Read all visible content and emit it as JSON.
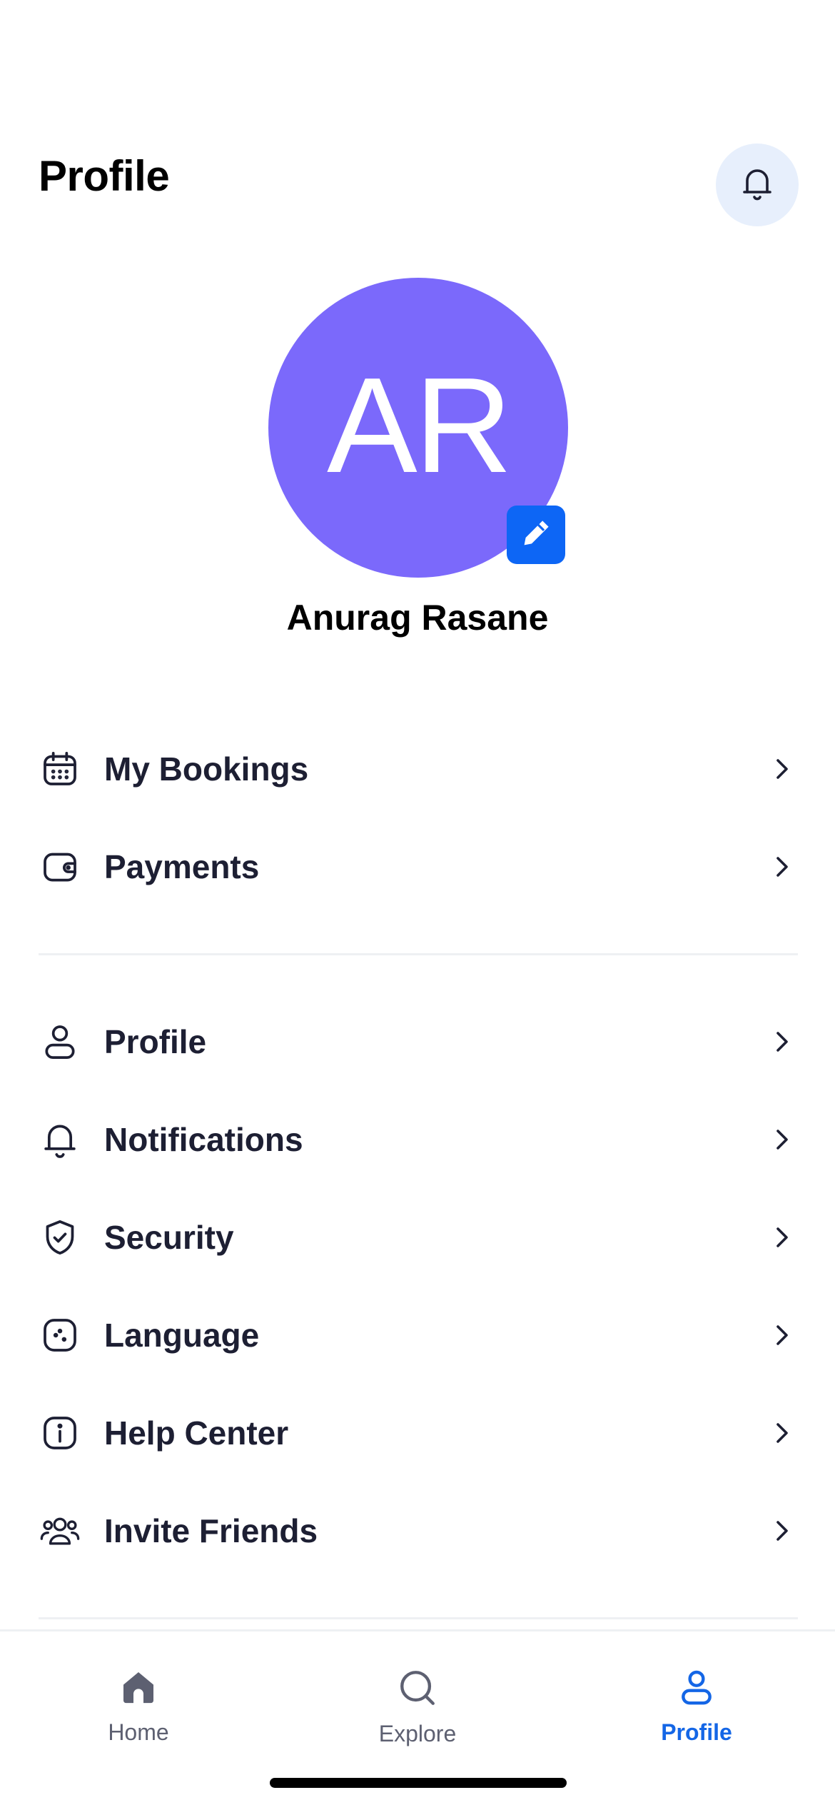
{
  "header": {
    "title": "Profile",
    "notification_icon": "bell-icon"
  },
  "profile": {
    "initials": "AR",
    "name": "Anurag Rasane",
    "avatar_color": "#7b69fb",
    "edit_icon": "pencil-icon",
    "edit_color": "#0d66f5"
  },
  "menu_groups": [
    {
      "items": [
        {
          "label": "My Bookings",
          "icon": "calendar-icon"
        },
        {
          "label": "Payments",
          "icon": "wallet-icon"
        }
      ]
    },
    {
      "items": [
        {
          "label": "Profile",
          "icon": "user-icon"
        },
        {
          "label": "Notifications",
          "icon": "bell-icon"
        },
        {
          "label": "Security",
          "icon": "shield-check-icon"
        },
        {
          "label": "Language",
          "icon": "language-icon"
        },
        {
          "label": "Help Center",
          "icon": "info-icon"
        },
        {
          "label": "Invite Friends",
          "icon": "users-icon"
        }
      ]
    }
  ],
  "tabbar": {
    "tabs": [
      {
        "label": "Home",
        "icon": "home-icon",
        "active": false
      },
      {
        "label": "Explore",
        "icon": "search-icon",
        "active": false
      },
      {
        "label": "Profile",
        "icon": "user-icon",
        "active": true
      }
    ],
    "active_color": "#1466e6",
    "inactive_color": "#5d6071"
  }
}
